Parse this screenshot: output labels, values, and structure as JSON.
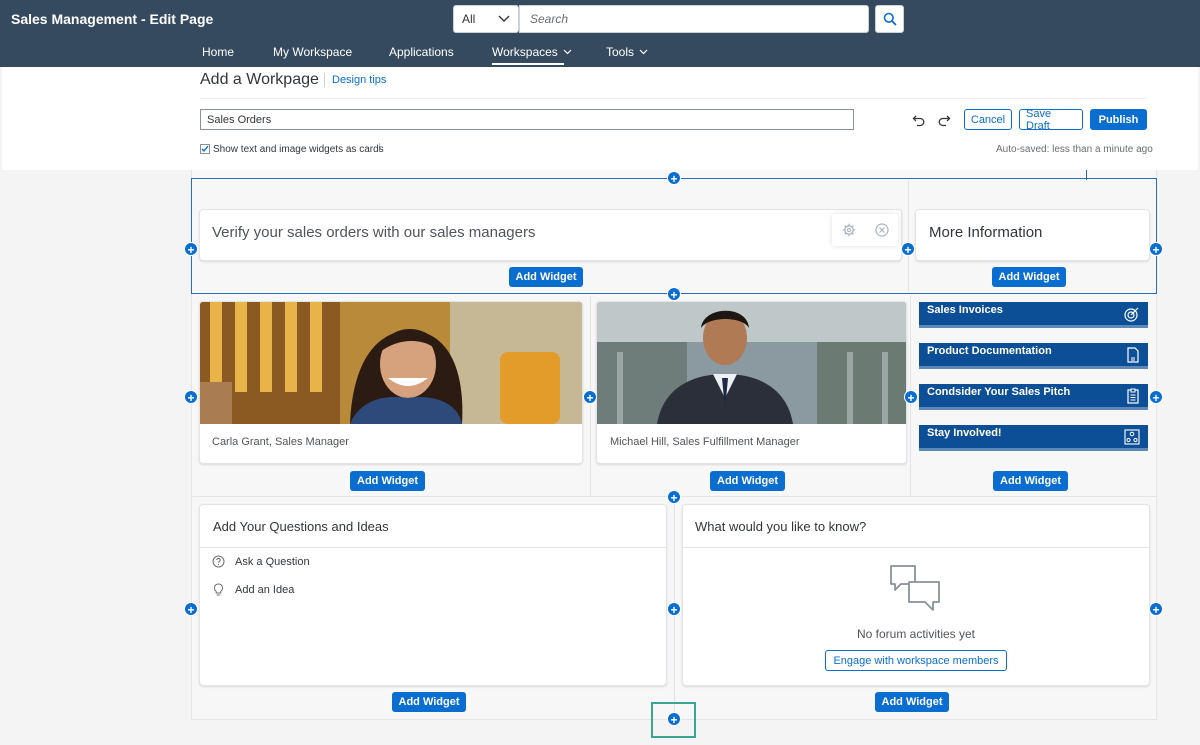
{
  "app": {
    "title": "Sales Management - Edit Page"
  },
  "search": {
    "scope": "All",
    "placeholder": "Search"
  },
  "nav": {
    "items": [
      "Home",
      "My Workspace",
      "Applications",
      "Workspaces",
      "Tools"
    ],
    "active": "Workspaces"
  },
  "header": {
    "title": "Add a Workpage",
    "design_tips": "Design tips",
    "title_value": "Sales Orders",
    "show_cards_label": "Show text and image widgets as cards",
    "show_cards_checked": true,
    "cancel": "Cancel",
    "save_draft": "Save Draft",
    "publish": "Publish",
    "autosave": "Auto-saved: less than a minute ago"
  },
  "colors": {
    "shell": "#354a5f",
    "accent": "#0a6ed1",
    "tile": "#0d4f97",
    "highlight": "#3ba58f"
  },
  "sections": {
    "s1": {
      "text_widget": "Verify your sales orders with our sales managers",
      "more_info": "More Information",
      "add_widget": "Add Widget"
    },
    "s2": {
      "person1_caption": "Carla Grant, Sales Manager",
      "person2_caption": "Michael Hill, Sales Fulfillment Manager",
      "tiles": [
        {
          "label": "Sales Invoices",
          "icon": "target-icon"
        },
        {
          "label": "Product Documentation",
          "icon": "document-icon"
        },
        {
          "label": "Condsider Your Sales Pitch",
          "icon": "clipboard-icon"
        },
        {
          "label": "Stay Involved!",
          "icon": "people-network-icon"
        }
      ],
      "add_widget": "Add Widget"
    },
    "s3": {
      "questions_title": "Add Your Questions and Ideas",
      "ask_question": "Ask a Question",
      "add_idea": "Add an Idea",
      "forum_title": "What would you like to know?",
      "no_activities": "No forum activities yet",
      "engage_button": "Engage with workspace members",
      "add_widget": "Add Widget"
    }
  }
}
